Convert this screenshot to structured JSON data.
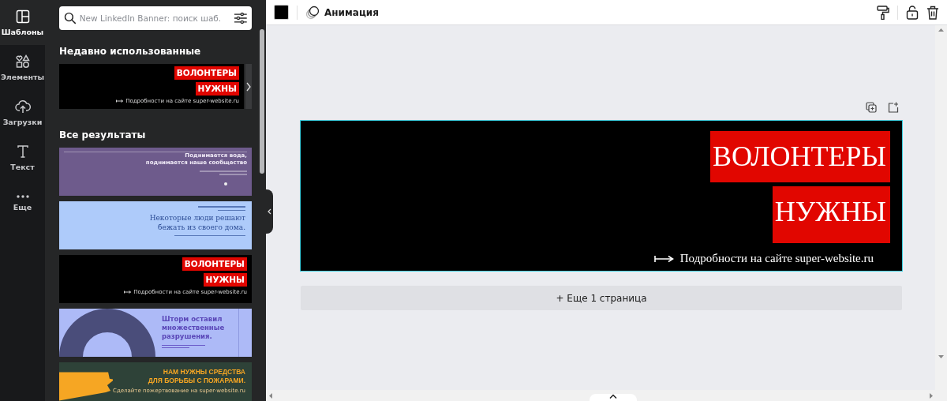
{
  "rail": [
    {
      "label": "Шаблоны",
      "selected": true
    },
    {
      "label": "Элементы",
      "selected": false
    },
    {
      "label": "Загрузки",
      "selected": false
    },
    {
      "label": "Текст",
      "selected": false
    },
    {
      "label": "Еще",
      "selected": false
    }
  ],
  "search": {
    "placeholder": "New LinkedIn Banner: поиск шаб."
  },
  "recent": {
    "title": "Недавно использованные",
    "items": [
      {
        "kind": "volunteer",
        "line1": "ВОЛОНТЕРЫ",
        "line2": "НУЖНЫ",
        "details": "Подробности на сайте super-website.ru"
      }
    ]
  },
  "results": {
    "title": "Все результаты",
    "items": [
      {
        "kind": "purple",
        "lines": [
          "Поднимается вода,",
          "поднимается наше сообщество"
        ]
      },
      {
        "kind": "blue",
        "lines": [
          "Некоторые люди решают",
          "бежать из своего дома."
        ]
      },
      {
        "kind": "volunteer",
        "line1": "ВОЛОНТЕРЫ",
        "line2": "НУЖНЫ",
        "details": "Подробности на сайте super-website.ru"
      },
      {
        "kind": "storm",
        "lines": [
          "Шторм оставил",
          "множественные",
          "разрушения."
        ]
      },
      {
        "kind": "fire",
        "lines": [
          "НАМ НУЖНЫ СРЕДСТВА",
          "ДЛЯ БОРЬБЫ С ПОЖАРАМИ."
        ],
        "details": "Сделайте пожертвование на super-website.ru"
      }
    ]
  },
  "toolbar": {
    "color": "#000000",
    "animation": "Анимация"
  },
  "design": {
    "line1": "ВОЛОНТЕРЫ",
    "line2": "НУЖНЫ",
    "details": "Подробности на сайте super-website.ru"
  },
  "add_page": "+ Еще 1 страница"
}
